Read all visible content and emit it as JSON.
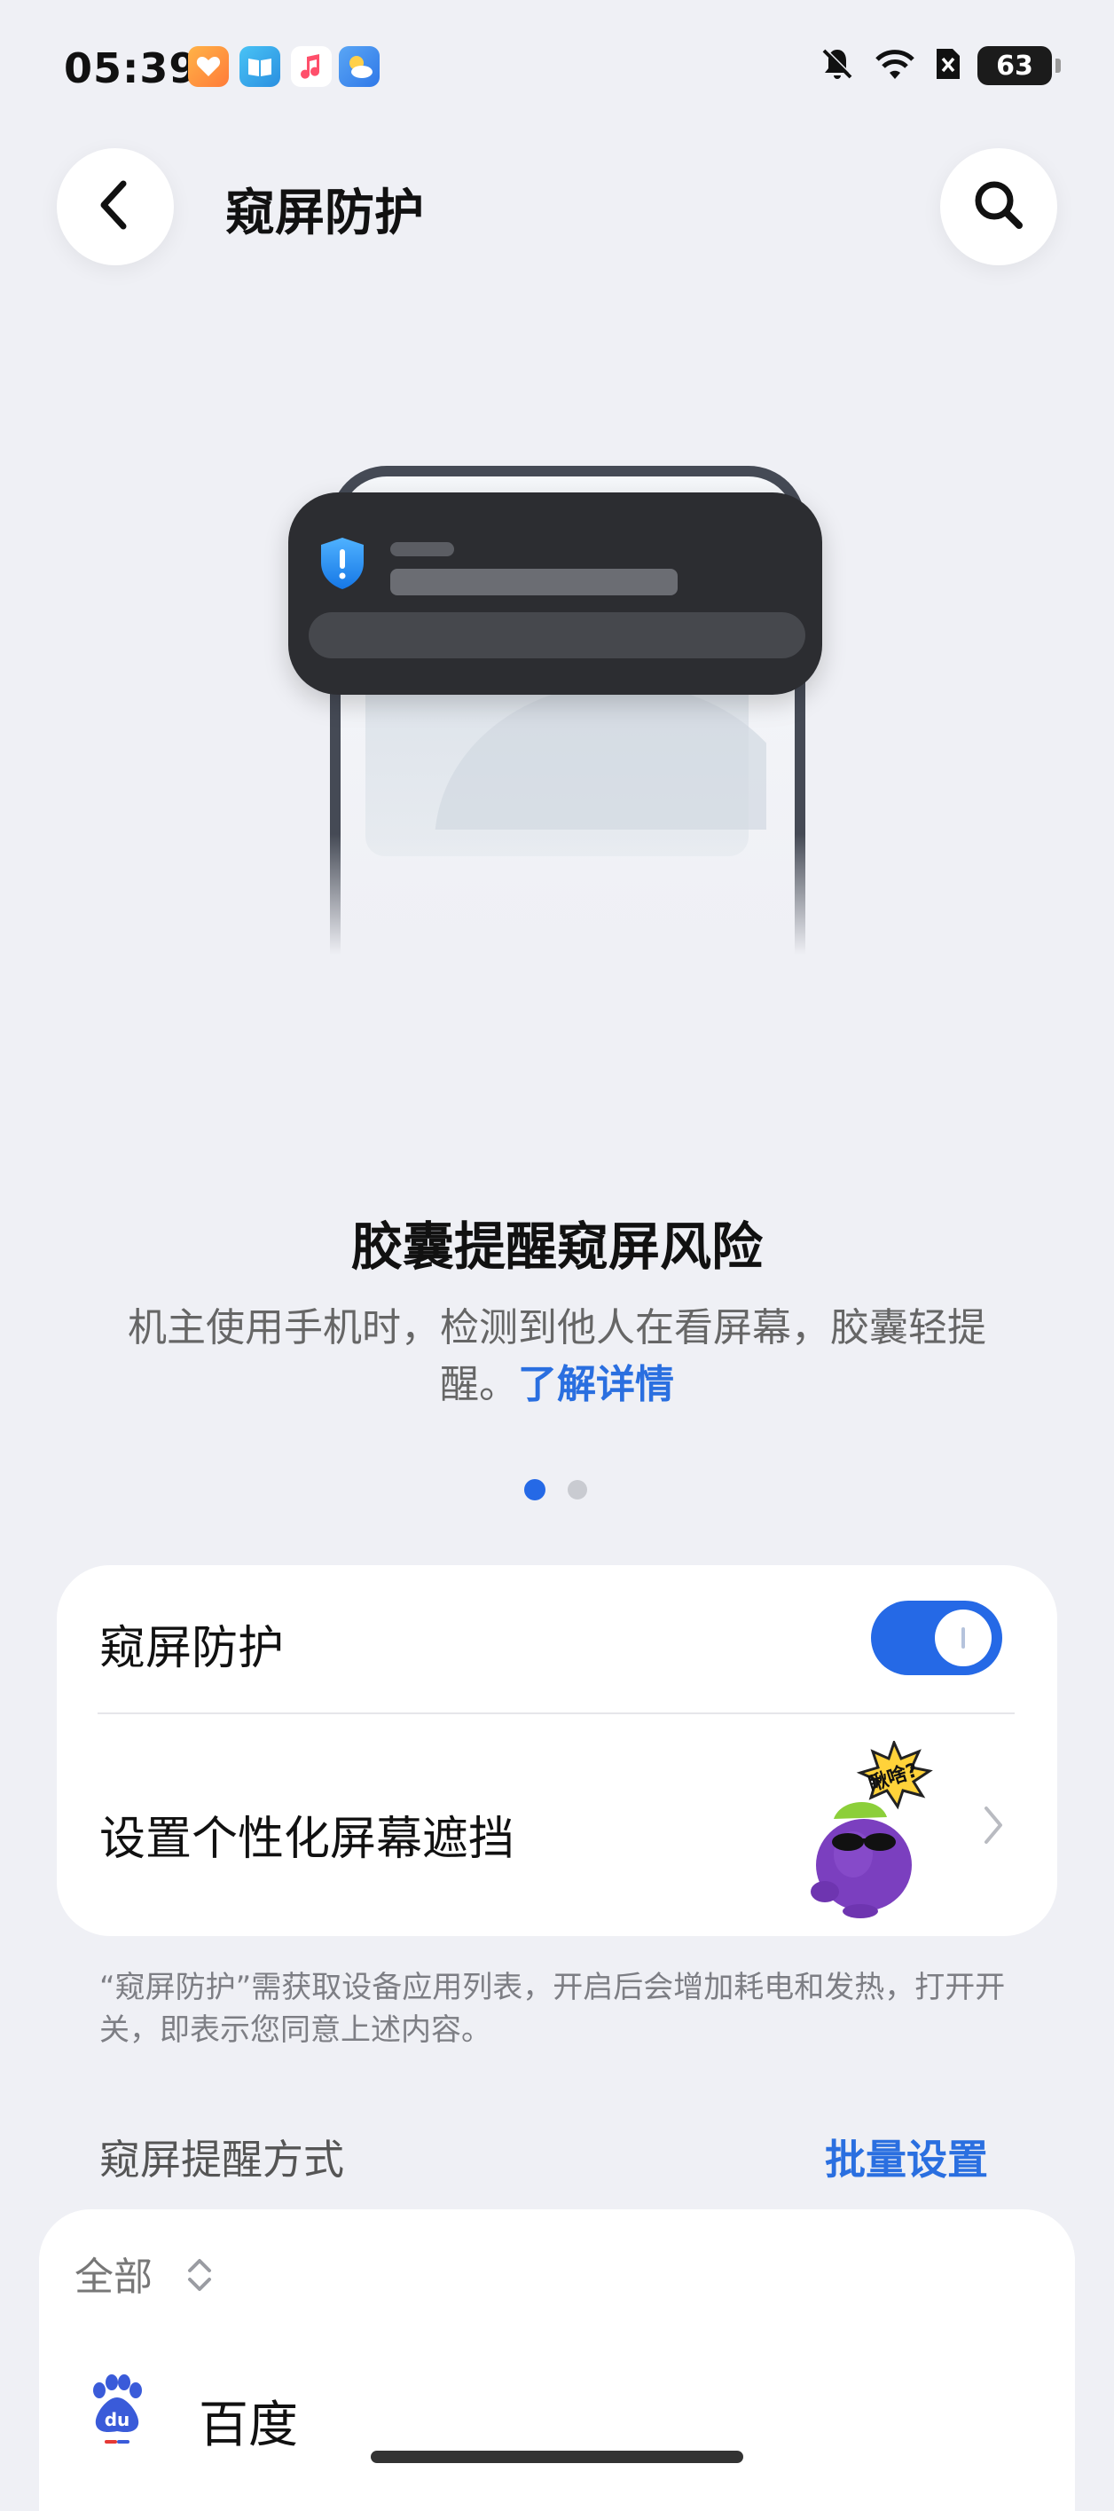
{
  "status_bar": {
    "time": "05:39",
    "battery_level": "63",
    "icons": [
      "health-app-icon",
      "books-app-icon",
      "music-app-icon",
      "weather-app-icon",
      "mute-icon",
      "wifi-icon",
      "sim-blocked-icon",
      "battery-icon"
    ]
  },
  "header": {
    "title": "窥屏防护",
    "back_icon": "chevron-left-icon",
    "search_icon": "search-icon"
  },
  "illustration": {
    "type": "capsule-alert-on-phone",
    "alert_icon": "shield-alert-icon",
    "colors": {
      "capsule": "#2c2d31",
      "shield": "#1e90ff"
    }
  },
  "feature": {
    "title": "胶囊提醒窥屏风险",
    "description_line1": "机主使用手机时，检测到他人在看屏幕，胶囊轻提",
    "description_line2": "醒。",
    "learn_more": "了解详情"
  },
  "pager": {
    "current": 1,
    "total": 2,
    "active_color": "#2569e6",
    "inactive_color": "#c9cbd1"
  },
  "settings_card": {
    "protection_label": "窥屏防护",
    "protection_enabled": true,
    "personalize_label": "设置个性化屏幕遮挡",
    "mascot_bubble": "瞅啥?"
  },
  "note": "“窥屏防护”需获取设备应用列表，开启后会增加耗电和发热，打开开关，即表示您同意上述内容。",
  "section": {
    "label": "窥屏提醒方式",
    "batch_action": "批量设置"
  },
  "app_list": {
    "filter": "全部",
    "apps": [
      {
        "name": "百度",
        "icon": "baidu-app-icon"
      }
    ]
  },
  "colors": {
    "accent": "#2569e6",
    "background": "#eff0f5",
    "link": "#2a6fe0"
  }
}
